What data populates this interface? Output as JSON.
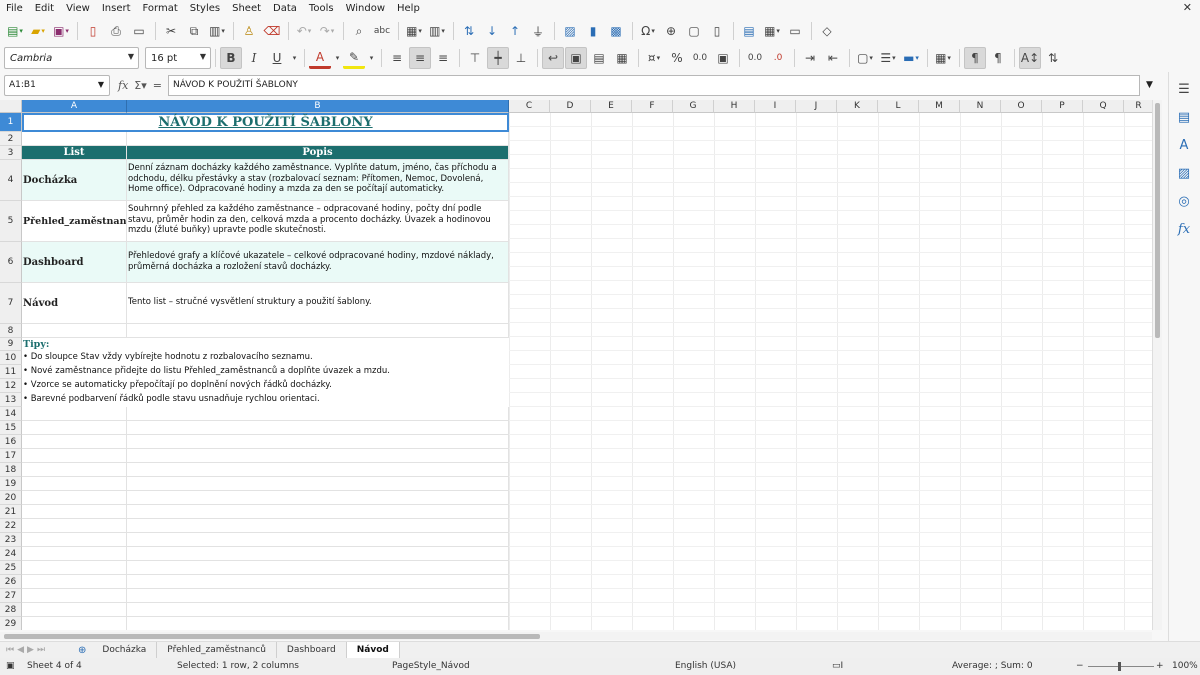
{
  "menu": [
    "File",
    "Edit",
    "View",
    "Insert",
    "Format",
    "Styles",
    "Sheet",
    "Data",
    "Tools",
    "Window",
    "Help"
  ],
  "toolbar": {
    "font_name": "Cambria",
    "font_size": "16 pt",
    "bold_label": "B",
    "italic_label": "I",
    "underline_label": "U",
    "percent_label": "%",
    "decimal_label": "0.0"
  },
  "formula": {
    "cell_ref": "A1:B1",
    "content": "NÁVOD K POUŽITÍ ŠABLONY"
  },
  "columns": [
    "A",
    "B",
    "C",
    "D",
    "E",
    "F",
    "G",
    "H",
    "I",
    "J",
    "K",
    "L",
    "M",
    "N",
    "O",
    "P",
    "Q",
    "R"
  ],
  "rows": [
    "1",
    "2",
    "3",
    "4",
    "5",
    "6",
    "7",
    "8",
    "9",
    "10",
    "11",
    "12",
    "13",
    "14",
    "15",
    "16",
    "17",
    "18",
    "19",
    "20",
    "21",
    "22",
    "23",
    "24",
    "25",
    "26",
    "27",
    "28",
    "29"
  ],
  "sheet": {
    "title": "NÁVOD K POUŽITÍ ŠABLONY",
    "header_list": "List",
    "header_desc": "Popis",
    "entries": [
      {
        "name": "Docházka",
        "desc": "Denní záznam docházky každého zaměstnance. Vyplňte datum, jméno, čas příchodu a odchodu, délku přestávky a stav (rozbalovací seznam: Přítomen, Nemoc, Dovolená, Home office). Odpracované hodiny a mzda za den se počítají automaticky."
      },
      {
        "name": "Přehled_zaměstnanců",
        "desc": "Souhrnný přehled za každého zaměstnance – odpracované hodiny, počty dní podle stavu, průměr hodin za den, celková mzda a procento docházky. Úvazek a hodinovou mzdu (žluté buňky) upravte podle skutečnosti."
      },
      {
        "name": "Dashboard",
        "desc": "Přehledové grafy a klíčové ukazatele – celkové odpracované hodiny, mzdové náklady, průměrná docházka a rozložení stavů docházky."
      },
      {
        "name": "Návod",
        "desc": "Tento list – stručné vysvětlení struktury a použití šablony."
      }
    ],
    "tips_title": "Tipy:",
    "tips": [
      "• Do sloupce Stav vždy vybírejte hodnotu z rozbalovacího seznamu.",
      "• Nové zaměstnance přidejte do listu Přehled_zaměstnanců a doplňte úvazek a mzdu.",
      "• Vzorce se automaticky přepočítají po doplnění nových řádků docházky.",
      "• Barevné podbarvení řádků podle stavu usnadňuje rychlou orientaci."
    ]
  },
  "tabs": [
    {
      "label": "Docházka",
      "active": false
    },
    {
      "label": "Přehled_zaměstnanců",
      "active": false
    },
    {
      "label": "Dashboard",
      "active": false
    },
    {
      "label": "Návod",
      "active": true
    }
  ],
  "status": {
    "sheet_pos": "Sheet 4 of 4",
    "selection": "Selected: 1 row, 2 columns",
    "page_style": "PageStyle_Návod",
    "language": "English (USA)",
    "summary": "Average: ; Sum: 0",
    "zoom": "100%"
  },
  "colors": {
    "header_teal": "#1c6e6e",
    "selection_blue": "#3e8ad6",
    "row_tint": "#eafaf7"
  }
}
